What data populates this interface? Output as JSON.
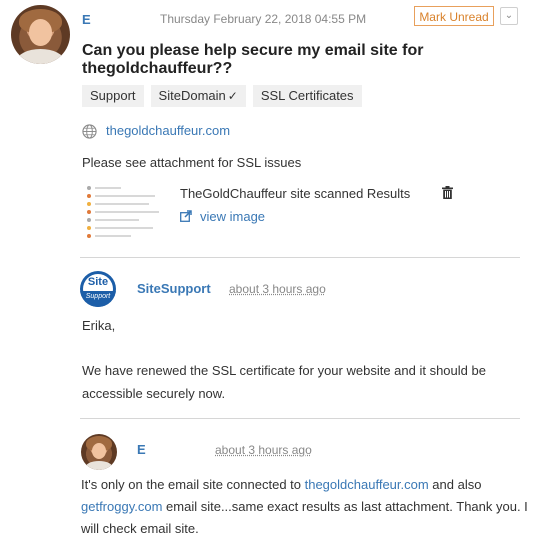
{
  "message": {
    "author": "E",
    "date": "Thursday February 22, 2018 04:55 PM",
    "mark_unread_label": "Mark Unread",
    "menu_icon": "chevron-down-icon",
    "subject": "Can you please help secure my email site for thegoldchauffeur??",
    "tags": [
      "Support",
      "SiteDomain",
      "SSL Certificates"
    ],
    "tag_checked": "SiteDomain",
    "website": "thegoldchauffeur.com",
    "body": "Please see attachment for SSL issues",
    "attachment": {
      "name": "TheGoldChauffeur site scanned Results",
      "view_label": "view image"
    }
  },
  "replies": [
    {
      "author": "SiteSupport",
      "logo_top": "Site",
      "logo_bottom": "Support",
      "time": "about 3 hours ago",
      "greeting": "Erika,",
      "body": "We have renewed the SSL certificate for your website and it should be accessible securely now."
    },
    {
      "author": "E",
      "time": "about 3 hours ago",
      "body_parts": {
        "before": "It's only on the email site connected to ",
        "link1": "thegoldchauffeur.com",
        "middle": " and also ",
        "link2": "getfroggy.com",
        "after": " email site...same exact results as last attachment. Thank you. I will check email site."
      }
    }
  ],
  "colors": {
    "link": "#3a78b5",
    "mark_unread": "#d9822b",
    "site_logo": "#1c5ea8"
  }
}
